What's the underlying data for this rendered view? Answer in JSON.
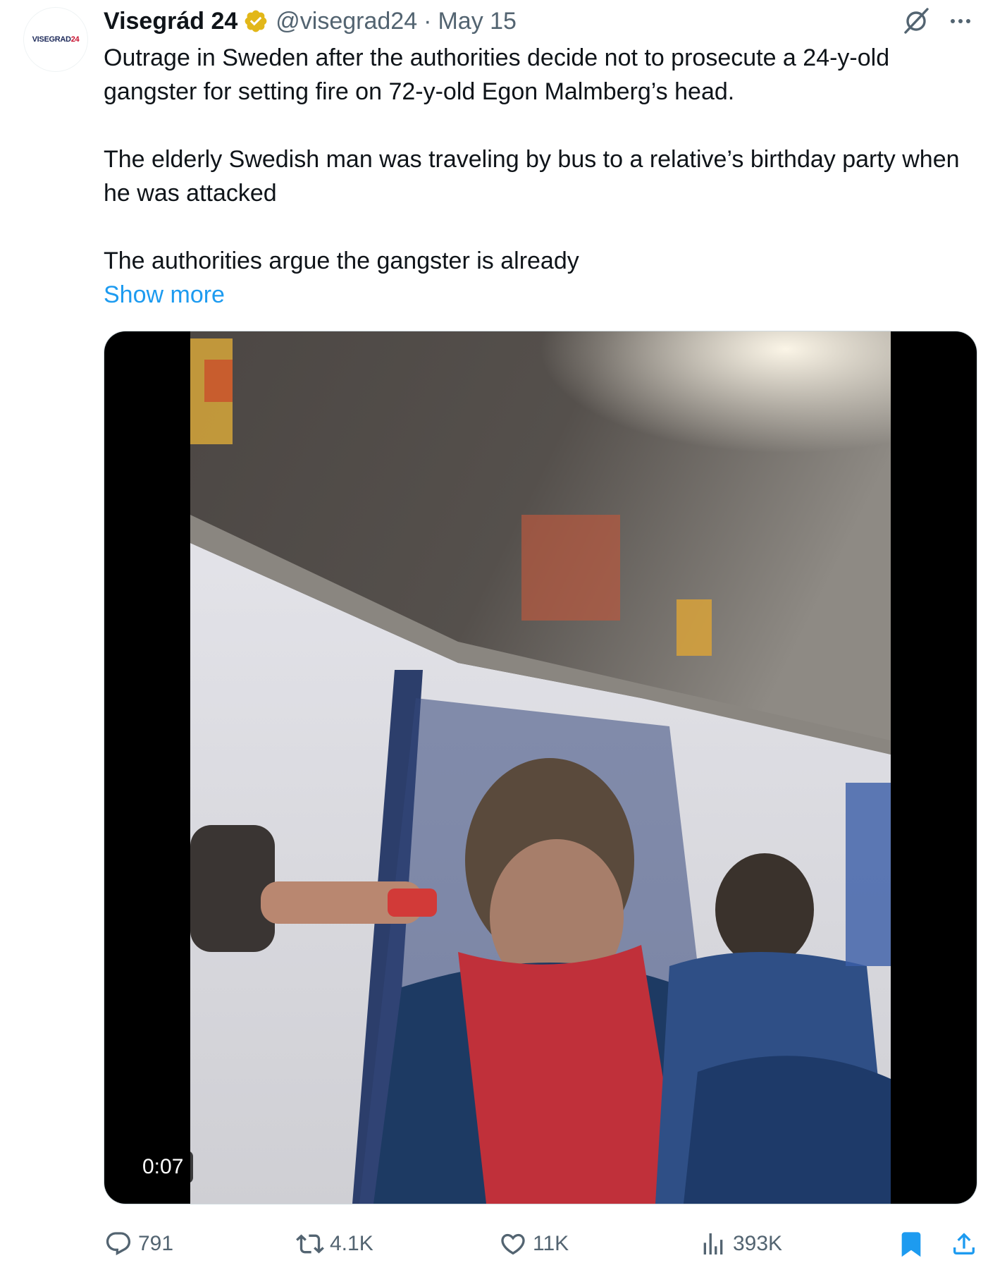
{
  "author": {
    "avatar_text": "VISEGRAD",
    "avatar_text_num": "24",
    "name": "Visegrád 24",
    "handle": "@visegrad24",
    "separator": "·",
    "date": "May 15"
  },
  "colors": {
    "link": "#1d9bf0",
    "verified": "#e2b719",
    "secondary_text": "#536471",
    "bookmark_active": "#1d9bf0"
  },
  "tweet": {
    "paragraphs": [
      "Outrage in Sweden after the authorities decide not to prosecute a 24-y-old gangster for setting fire on 72-y-old Egon Malmberg’s head.",
      "The elderly Swedish man was traveling by bus to a relative’s birthday party when he was attacked",
      "The authorities argue the gangster is already"
    ],
    "show_more_label": "Show more"
  },
  "media": {
    "duration": "0:07"
  },
  "actions": {
    "replies": "791",
    "retweets": "4.1K",
    "likes": "11K",
    "views": "393K",
    "bookmarked": true
  },
  "icons": {
    "verified": "verified-badge-icon",
    "grok": "grok-icon",
    "more": "more-dots-icon",
    "reply": "reply-icon",
    "retweet": "retweet-icon",
    "like": "heart-icon",
    "views": "views-chart-icon",
    "bookmark": "bookmark-icon",
    "share": "share-icon"
  }
}
